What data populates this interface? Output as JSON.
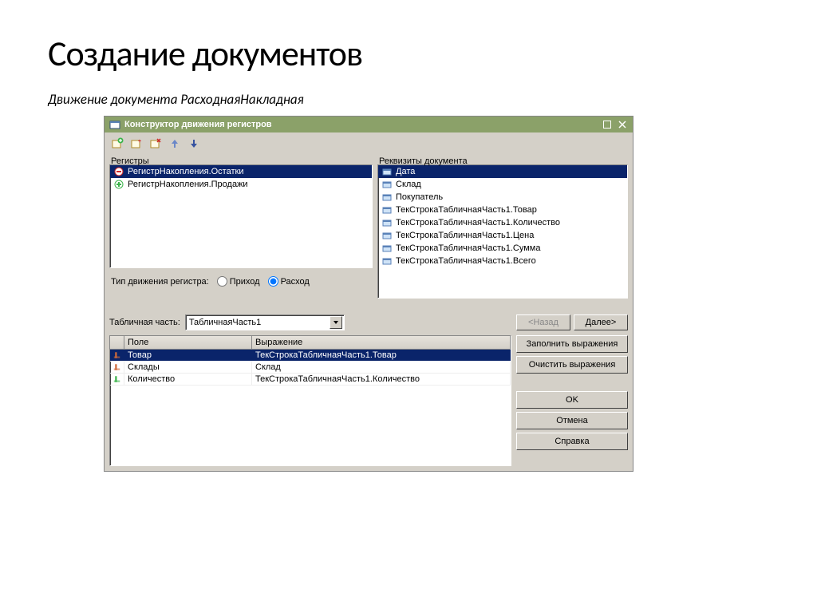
{
  "slide": {
    "title": "Создание документов",
    "subtitle": "Движение документа РасходнаяНакладная"
  },
  "window": {
    "title": "Конструктор движения регистров"
  },
  "toolbar": {
    "add": "add-icon",
    "addX": "add-x-icon",
    "delX": "delete-x-icon",
    "up": "arrow-up-icon",
    "down": "arrow-down-icon"
  },
  "registers": {
    "label": "Регистры",
    "items": [
      {
        "name": "РегистрНакопления.Остатки",
        "selected": true,
        "icon": "minus"
      },
      {
        "name": "РегистрНакопления.Продажи",
        "selected": false,
        "icon": "plus"
      }
    ]
  },
  "moveType": {
    "label": "Тип движения регистра:",
    "optIncome": "Приход",
    "optExpense": "Расход",
    "selected": "Расход"
  },
  "docAttrs": {
    "label": "Реквизиты документа",
    "items": [
      {
        "name": "Дата",
        "selected": true
      },
      {
        "name": "Склад",
        "selected": false
      },
      {
        "name": "Покупатель",
        "selected": false
      },
      {
        "name": "ТекСтрокаТабличнаяЧасть1.Товар",
        "selected": false
      },
      {
        "name": "ТекСтрокаТабличнаяЧасть1.Количество",
        "selected": false
      },
      {
        "name": "ТекСтрокаТабличнаяЧасть1.Цена",
        "selected": false
      },
      {
        "name": "ТекСтрокаТабличнаяЧасть1.Сумма",
        "selected": false
      },
      {
        "name": "ТекСтрокаТабличнаяЧасть1.Всего",
        "selected": false
      }
    ]
  },
  "tabularPart": {
    "label": "Табличная часть:",
    "value": "ТабличнаяЧасть1"
  },
  "grid": {
    "colField": "Поле",
    "colExpr": "Выражение",
    "rows": [
      {
        "field": "Товар",
        "expr": "ТекСтрокаТабличнаяЧасть1.Товар",
        "selected": true,
        "icon": "dim-red"
      },
      {
        "field": "Склады",
        "expr": "Склад",
        "selected": false,
        "icon": "dim-red"
      },
      {
        "field": "Количество",
        "expr": "ТекСтрокаТабличнаяЧасть1.Количество",
        "selected": false,
        "icon": "res-green"
      }
    ]
  },
  "buttons": {
    "back": "<Назад",
    "next": "Далее>",
    "fillExpr": "Заполнить выражения",
    "clearExpr": "Очистить выражения",
    "ok": "OK",
    "cancel": "Отмена",
    "help": "Справка"
  }
}
